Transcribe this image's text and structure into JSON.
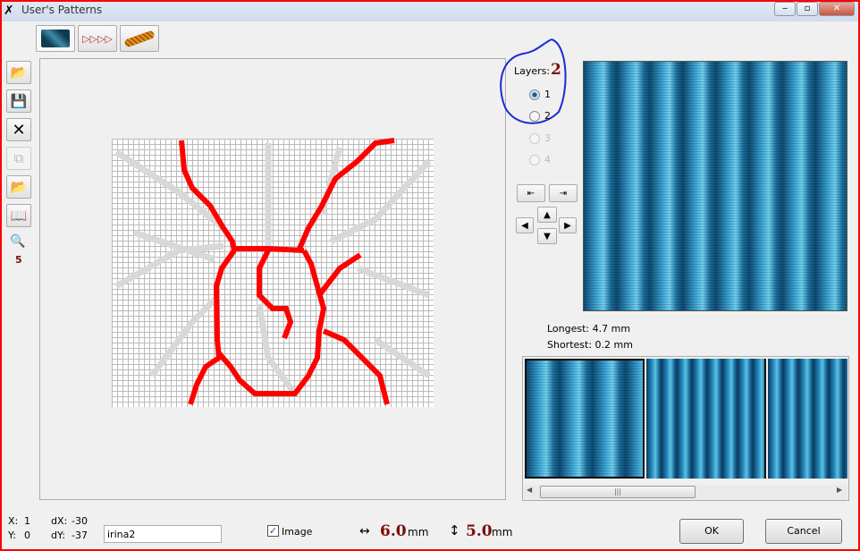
{
  "window": {
    "title": "User's Patterns",
    "minimize": "‒",
    "restore": "▫",
    "close": "✕"
  },
  "pattern_tabs": [
    {
      "name": "fill-pattern"
    },
    {
      "name": "arrow-pattern"
    },
    {
      "name": "rope-pattern"
    }
  ],
  "zoom_level": "5",
  "layers": {
    "label": "Layers:",
    "count": "2",
    "options": [
      {
        "label": "1",
        "selected": true,
        "enabled": true
      },
      {
        "label": "2",
        "selected": false,
        "enabled": true
      },
      {
        "label": "3",
        "enabled": false
      },
      {
        "label": "4",
        "enabled": false
      }
    ]
  },
  "stitch_info": {
    "longest": "Longest: 4.7 mm",
    "shortest": "Shortest: 0.2 mm"
  },
  "status": {
    "x_label": "X:",
    "x": "1",
    "y_label": "Y:",
    "y": "0",
    "dx_label": "dX:",
    "dx": "-30",
    "dy_label": "dY:",
    "dy": "-37"
  },
  "name_field": {
    "value": "irina2"
  },
  "image_checkbox": {
    "label": "Image",
    "checked": true
  },
  "width": {
    "value": "6.0",
    "unit": "mm"
  },
  "height": {
    "value": "5.0",
    "unit": "mm"
  },
  "buttons": {
    "ok": "OK",
    "cancel": "Cancel"
  },
  "scrollbar_grip": "|||"
}
